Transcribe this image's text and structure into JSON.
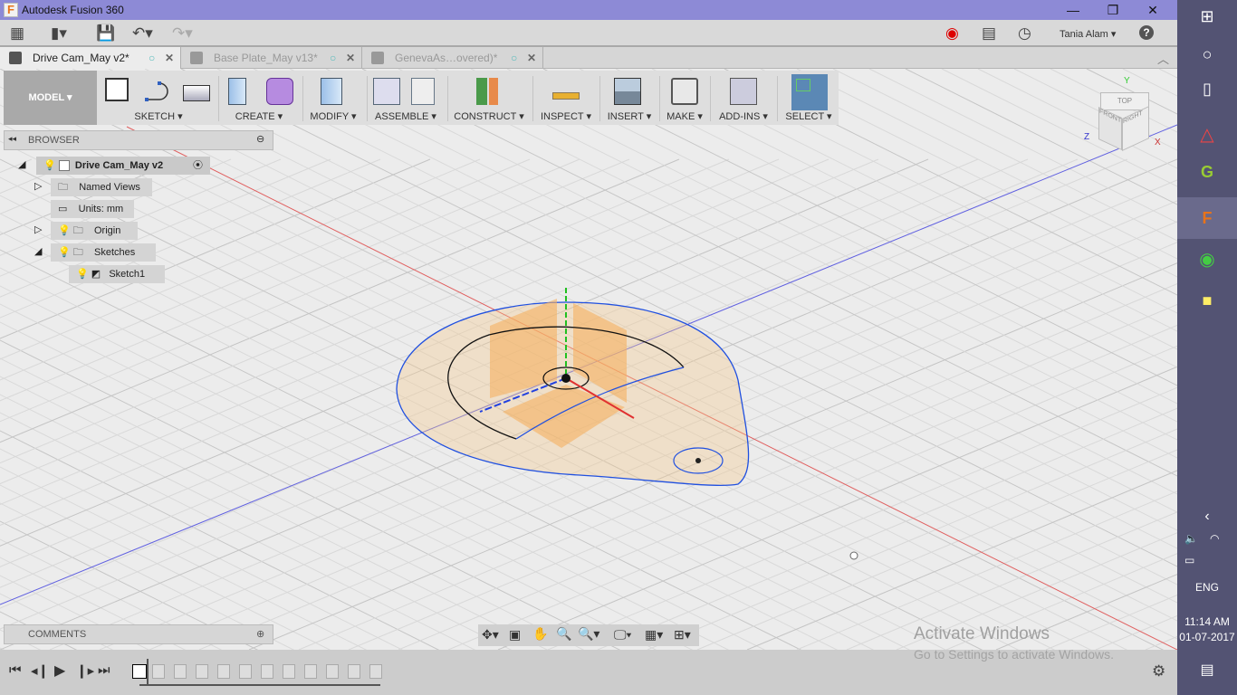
{
  "app": {
    "title": "Autodesk Fusion 360",
    "logo_letter": "F"
  },
  "window_controls": {
    "minimize": "—",
    "restore": "❐",
    "close": "✕"
  },
  "header": {
    "user": "Tania Alam",
    "help": "?"
  },
  "tabs": [
    {
      "label": "Drive Cam_May v2*",
      "active": true
    },
    {
      "label": "Base Plate_May v13*",
      "active": false
    },
    {
      "label": "GenevaAs…overed)*",
      "active": false
    }
  ],
  "ribbon": {
    "workspace": "MODEL ▾",
    "groups": [
      "SKETCH ▾",
      "CREATE ▾",
      "MODIFY ▾",
      "ASSEMBLE ▾",
      "CONSTRUCT ▾",
      "INSPECT ▾",
      "INSERT ▾",
      "MAKE ▾",
      "ADD-INS ▾",
      "SELECT ▾"
    ]
  },
  "browser": {
    "title": "BROWSER",
    "nodes": [
      {
        "label": "Drive Cam_May v2"
      },
      {
        "label": "Named Views"
      },
      {
        "label": "Units: mm"
      },
      {
        "label": "Origin"
      },
      {
        "label": "Sketches"
      },
      {
        "label": "Sketch1"
      }
    ]
  },
  "comments": {
    "title": "COMMENTS"
  },
  "viewcube": {
    "top": "TOP",
    "front": "FRONT",
    "right": "RIGHT",
    "y": "Y",
    "x": "X",
    "z": "Z"
  },
  "watermark": {
    "line1": "Activate Windows",
    "line2": "Go to Settings to activate Windows."
  },
  "taskbar": {
    "lang": "ENG",
    "time": "11:14 AM",
    "date": "01-07-2017"
  },
  "colors": {
    "titlebar": "#8d8ad6",
    "taskbar": "#535373",
    "select_active": "#5b88b5",
    "sketch_profile": "#f5c98a",
    "x_axis": "#e03030",
    "y_axis": "#20c020",
    "z_axis": "#2040e0"
  }
}
